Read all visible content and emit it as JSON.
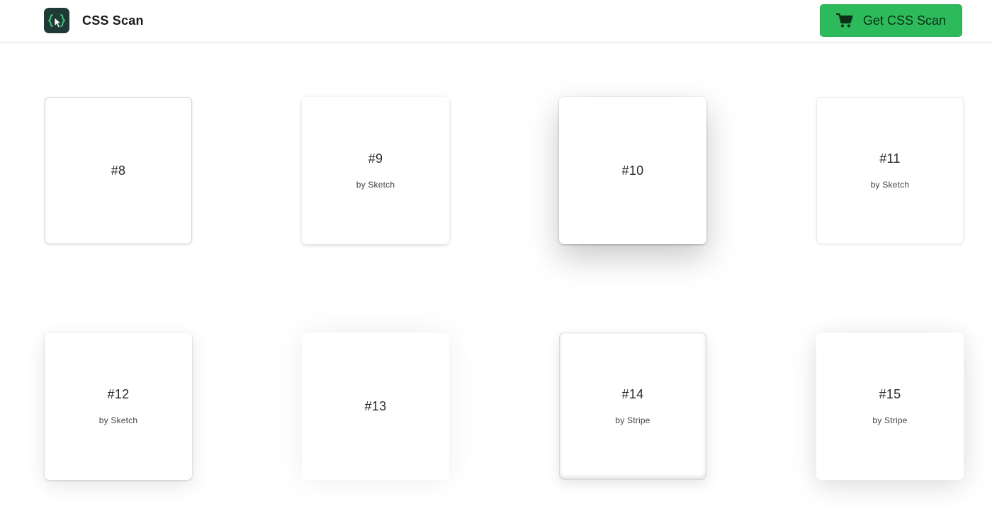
{
  "header": {
    "brand_name": "CSS Scan",
    "cta_label": "Get CSS Scan"
  },
  "icons": {
    "logo": "css-scan-logo-icon",
    "cart": "shopping-cart-icon"
  },
  "colors": {
    "accent": "#2dba5a",
    "logo_bg": "#1f3a36"
  },
  "cards": [
    {
      "label": "#8",
      "author": ""
    },
    {
      "label": "#9",
      "author": "by Sketch"
    },
    {
      "label": "#10",
      "author": ""
    },
    {
      "label": "#11",
      "author": "by Sketch"
    },
    {
      "label": "#12",
      "author": "by Sketch"
    },
    {
      "label": "#13",
      "author": ""
    },
    {
      "label": "#14",
      "author": "by Stripe"
    },
    {
      "label": "#15",
      "author": "by Stripe"
    }
  ]
}
